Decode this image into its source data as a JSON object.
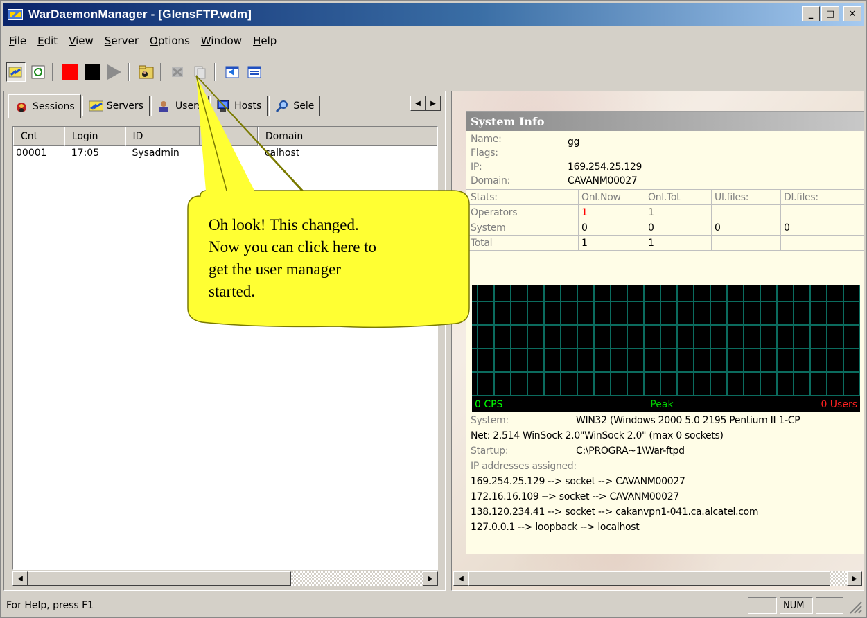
{
  "window": {
    "title": "WarDaemonManager - [GlensFTP.wdm]",
    "minimize_glyph": "_",
    "maximize_glyph": "□",
    "close_glyph": "✕"
  },
  "menu": [
    {
      "pre": "",
      "key": "F",
      "post": "ile"
    },
    {
      "pre": "",
      "key": "E",
      "post": "dit"
    },
    {
      "pre": "",
      "key": "V",
      "post": "iew"
    },
    {
      "pre": "",
      "key": "S",
      "post": "erver"
    },
    {
      "pre": "",
      "key": "O",
      "post": "ptions"
    },
    {
      "pre": "",
      "key": "W",
      "post": "indow"
    },
    {
      "pre": "",
      "key": "H",
      "post": "elp"
    }
  ],
  "tabs": {
    "sessions": "Sessions",
    "servers": "Servers",
    "users": "Users",
    "hosts": "Hosts",
    "select": "Sele"
  },
  "sessions_table": {
    "columns": [
      "Cnt",
      "Login",
      "ID",
      "",
      "Domain"
    ],
    "rows": [
      {
        "cnt": "00001",
        "login": "17:05",
        "id": "Sysadmin",
        "domain": "calhost"
      }
    ]
  },
  "system_info": {
    "title": "System Info",
    "name_label": "Name:",
    "name_value": "gg",
    "flags_label": "Flags:",
    "ip_label": "IP:",
    "ip_value": "169.254.25.129",
    "domain_label": "Domain:",
    "domain_value": "CAVANM00027",
    "stats": {
      "header": [
        "Stats:",
        "Onl.Now",
        "Onl.Tot",
        "Ul.files:",
        "Dl.files:"
      ],
      "operators": [
        "Operators",
        "1",
        "1",
        "",
        ""
      ],
      "system": [
        "System",
        "0",
        "0",
        "0",
        "0"
      ],
      "total": [
        "Total",
        "1",
        "1",
        "",
        ""
      ]
    },
    "graph": {
      "cps": "0 CPS",
      "peak": "Peak",
      "users": "0 Users"
    },
    "system_label": "System:",
    "system_value": "WIN32 (Windows 2000 5.0 2195 Pentium II 1-CP",
    "net_line": "Net: 2.514 WinSock 2.0\"WinSock 2.0\" (max 0 sockets)",
    "startup_label": "Startup:",
    "startup_value": "C:\\PROGRA~1\\War-ftpd",
    "ip_assigned_label": "IP addresses assigned:",
    "ip_lines": [
      "169.254.25.129 --> socket --> CAVANM00027",
      "172.16.16.109 --> socket --> CAVANM00027",
      "138.120.234.41 --> socket --> cakanvpn1-041.ca.alcatel.com",
      "127.0.0.1 --> loopback --> localhost"
    ]
  },
  "callout": {
    "lines": [
      "Oh look! This changed.",
      "Now you can click here to",
      "get the user manager",
      "started."
    ]
  },
  "status": {
    "help_text": "For Help, press F1",
    "num": "NUM"
  },
  "colors": {
    "titlebar": "#0a246a",
    "callout_fill": "#ffff33",
    "graph_grid": "#0b6b5e",
    "cps": "#00ff00",
    "peak": "#00d000",
    "users": "#ff2020",
    "operators_now": "#ff0000"
  }
}
